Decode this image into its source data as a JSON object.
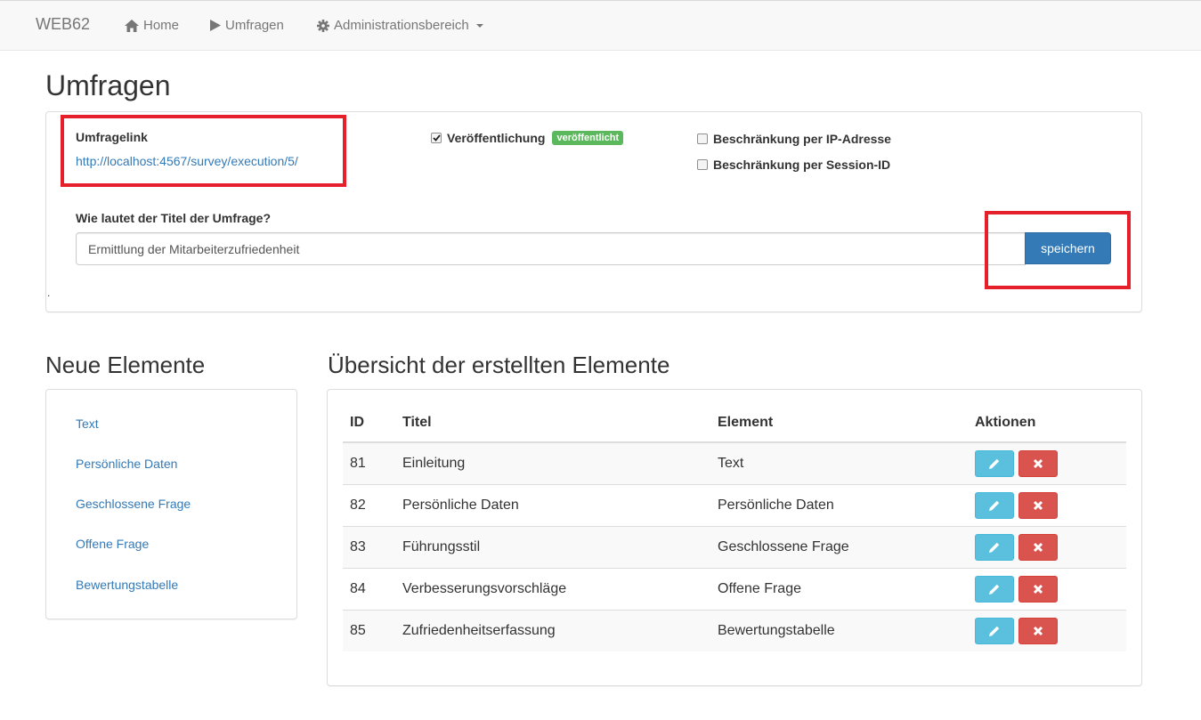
{
  "navbar": {
    "brand": "WEB62",
    "items": [
      {
        "label": "Home",
        "icon": "home-icon"
      },
      {
        "label": "Umfragen",
        "icon": "play-icon"
      },
      {
        "label": "Administrationsbereich",
        "icon": "gear-icon"
      }
    ]
  },
  "page_title": "Umfragen",
  "survey": {
    "link_label": "Umfragelink",
    "link_url": "http://localhost:4567/survey/execution/5/",
    "publication_label": "Veröffentlichung",
    "publication_checked": true,
    "publication_badge": "veröffentlicht",
    "restrict_ip_label": "Beschränkung per IP-Adresse",
    "restrict_session_label": "Beschränkung per Session-ID",
    "title_question": "Wie lautet der Titel der Umfrage?",
    "title_value": "Ermittlung der Mitarbeiterzufriedenheit",
    "save_label": "speichern",
    "stray_mark": "."
  },
  "new_elements": {
    "heading": "Neue Elemente",
    "items": [
      "Text",
      "Persönliche Daten",
      "Geschlossene Frage",
      "Offene Frage",
      "Bewertungstabelle"
    ]
  },
  "overview": {
    "heading": "Übersicht der erstellten Elemente",
    "columns": [
      "ID",
      "Titel",
      "Element",
      "Aktionen"
    ],
    "rows": [
      {
        "id": "81",
        "title": "Einleitung",
        "element": "Text"
      },
      {
        "id": "82",
        "title": "Persönliche Daten",
        "element": "Persönliche Daten"
      },
      {
        "id": "83",
        "title": "Führungsstil",
        "element": "Geschlossene Frage"
      },
      {
        "id": "84",
        "title": "Verbesserungsvorschläge",
        "element": "Offene Frage"
      },
      {
        "id": "85",
        "title": "Zufriedenheitserfassung",
        "element": "Bewertungstabelle"
      }
    ]
  },
  "colors": {
    "highlight": "#e6202a",
    "primary": "#337ab7",
    "success": "#5cb85c",
    "info": "#5bc0de",
    "danger": "#d9534f"
  }
}
